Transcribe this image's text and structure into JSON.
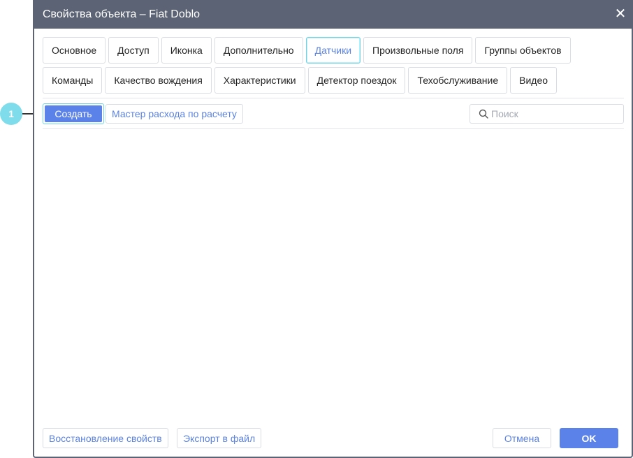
{
  "dialog": {
    "title": "Свойства объекта – Fiat Doblo",
    "close_icon": "close-icon"
  },
  "tabs": {
    "row1": [
      "Основное",
      "Доступ",
      "Иконка",
      "Дополнительно",
      "Датчики",
      "Произвольные поля",
      "Группы объектов"
    ],
    "row2": [
      "Команды",
      "Качество вождения",
      "Характеристики",
      "Детектор поездок",
      "Техобслуживание",
      "Видео"
    ],
    "active": "Датчики"
  },
  "toolbar": {
    "create_label": "Создать",
    "wizard_label": "Мастер расхода по расчету",
    "search_placeholder": "Поиск"
  },
  "footer": {
    "restore_label": "Восстановление свойств",
    "export_label": "Экспорт в файл",
    "cancel_label": "Отмена",
    "ok_label": "OK"
  },
  "callout": {
    "number": "1"
  },
  "colors": {
    "accent": "#5b82e8",
    "titlebar": "#5b6374",
    "highlight": "#6fd4e6"
  }
}
